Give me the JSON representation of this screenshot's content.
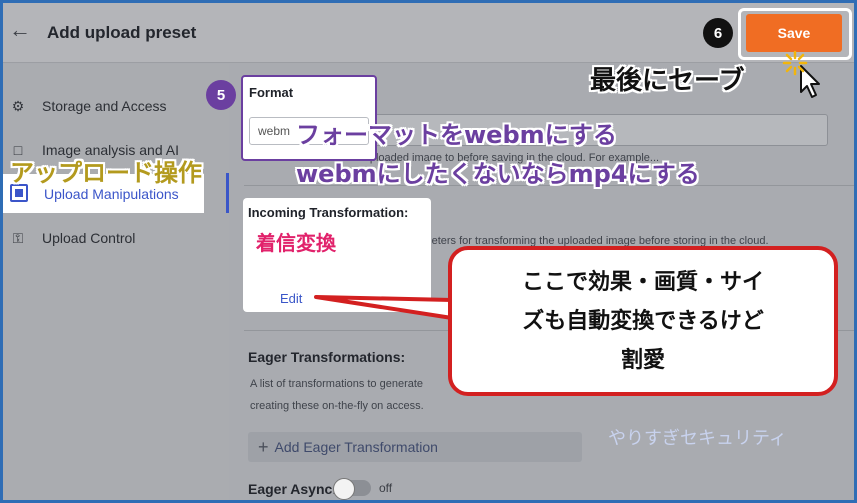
{
  "header": {
    "title": "Add upload preset",
    "save_label": "Save"
  },
  "sidebar": {
    "items": [
      {
        "label": "Storage and Access",
        "icon": "gear-doc-icon"
      },
      {
        "label": "Image analysis and AI",
        "icon": "scan-icon"
      },
      {
        "label": "Upload Manipulations",
        "icon": "manipulation-icon"
      },
      {
        "label": "Upload Control",
        "icon": "key-icon"
      }
    ]
  },
  "main": {
    "format": {
      "label": "Format",
      "value": "webm",
      "hint": "A format to convert the uploaded image to before saving in the cloud. For example..."
    },
    "incoming": {
      "title": "Incoming Transformation:",
      "hint": "A set of transformation-related parameters for transforming the uploaded image before storing in the cloud.",
      "edit_label": "Edit"
    },
    "eager": {
      "title": "Eager Transformations:",
      "hint_line1": "A list of transformations to generate",
      "hint_line2": "creating these on-the-fly on access.",
      "add_label": "Add Eager Transformation"
    },
    "eager_async": {
      "label": "Eager Async:",
      "value": "off"
    }
  },
  "annotations": {
    "badge5": "5",
    "badge6": "6",
    "save_note": "最後にセーブ",
    "format_note_line1": "フォーマットをwebmにする",
    "format_note_line2": "webmにしたくないならmp4にする",
    "manip_note": "アップロード操作",
    "incoming_note": "着信変換",
    "callout_line1": "ここで効果・画質・サイ",
    "callout_line2": "ズも自動変換できるけど",
    "callout_line3": "割愛",
    "watermark": "やりすぎセキュリティ"
  },
  "colors": {
    "accent": "#3b55c9",
    "save": "#f06d23",
    "badge5": "#6b3fa0",
    "callout_border": "#d32020"
  }
}
